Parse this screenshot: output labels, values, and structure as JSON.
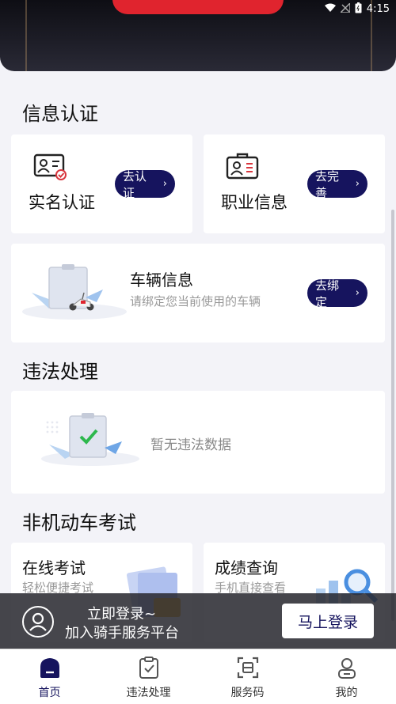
{
  "status_bar": {
    "time": "4:15",
    "icons": [
      "wifi-icon",
      "signal-off-icon",
      "battery-icon"
    ]
  },
  "sections": {
    "info_auth": {
      "title": "信息认证",
      "realname": {
        "label": "实名认证",
        "button": "去认证"
      },
      "profession": {
        "label": "职业信息",
        "button": "去完善"
      },
      "vehicle": {
        "label": "车辆信息",
        "hint": "请绑定您当前使用的车辆",
        "button": "去绑定"
      }
    },
    "violation": {
      "title": "违法处理",
      "empty_text": "暂无违法数据"
    },
    "exam": {
      "title": "非机动车考试",
      "online": {
        "title": "在线考试",
        "subtitle": "轻松便捷考试"
      },
      "score": {
        "title": "成绩查询",
        "subtitle": "手机直接查看"
      }
    }
  },
  "login_banner": {
    "line1": "立即登录~",
    "line2": "加入骑手服务平台",
    "button": "马上登录"
  },
  "tabbar": [
    {
      "label": "首页",
      "icon": "home-icon",
      "active": true
    },
    {
      "label": "违法处理",
      "icon": "clipboard-check-icon",
      "active": false
    },
    {
      "label": "服务码",
      "icon": "scan-code-icon",
      "active": false
    },
    {
      "label": "我的",
      "icon": "user-icon",
      "active": false
    }
  ],
  "colors": {
    "accent": "#16145e",
    "header_red": "#e0242e",
    "background": "#f3f3f8"
  }
}
